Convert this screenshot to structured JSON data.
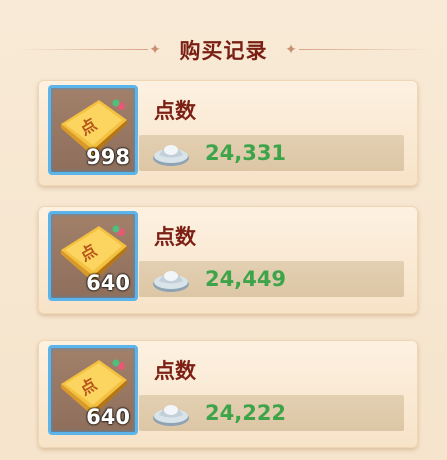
{
  "header": {
    "title": "购买记录"
  },
  "records": [
    {
      "item_name": "点数",
      "quantity": "998",
      "price": "24,331"
    },
    {
      "item_name": "点数",
      "quantity": "640",
      "price": "24,449"
    },
    {
      "item_name": "点数",
      "quantity": "640",
      "price": "24,222"
    }
  ],
  "icons": {
    "item": "point-book-icon",
    "currency": "silver-ingot-icon",
    "ornament": "ornament-icon"
  },
  "colors": {
    "title": "#7a1e14",
    "item_name": "#7c1f14",
    "price": "#3ea44a",
    "icon_border": "#5bb4ea"
  }
}
